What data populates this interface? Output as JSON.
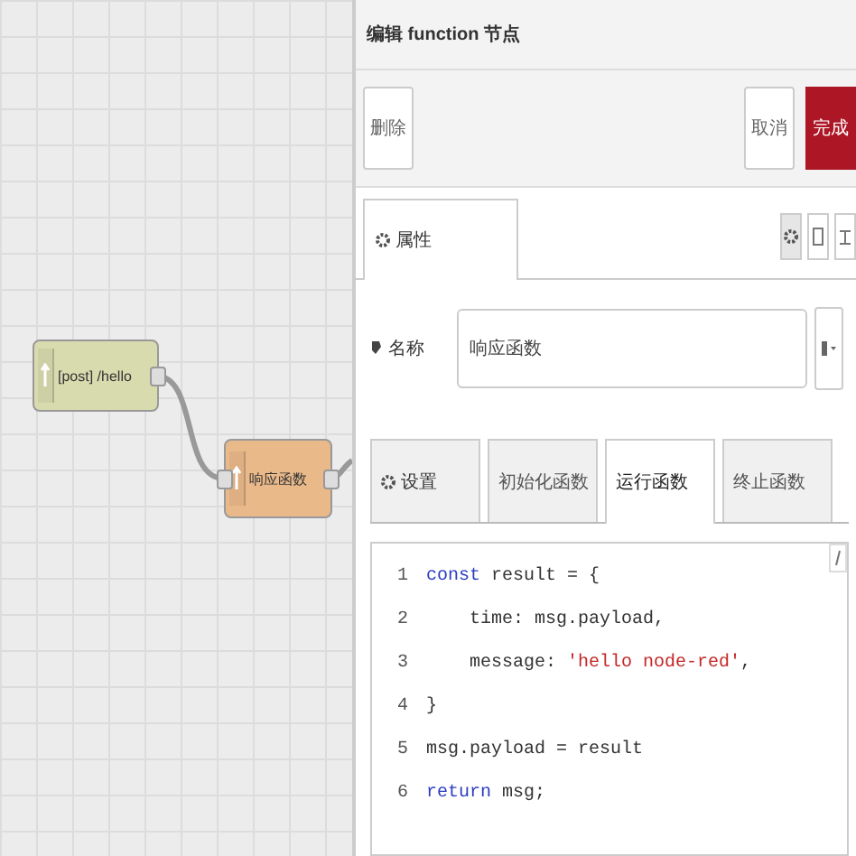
{
  "canvas": {
    "nodes": [
      {
        "label": "[post] /hello",
        "color": "#d8dbae"
      },
      {
        "label": "响应函数",
        "color": "#e9b98a"
      }
    ]
  },
  "tray": {
    "title": "编辑 function 节点",
    "buttons": [
      {
        "label": "删除",
        "kind": "plain"
      },
      {
        "label": "取消",
        "kind": "plain"
      },
      {
        "label": "完成",
        "kind": "primary"
      }
    ],
    "tabs": [
      {
        "label": "属性",
        "selected": true
      }
    ],
    "name_field": {
      "label": "名称",
      "value": "响应函数"
    },
    "sub_tabs": [
      {
        "label": "设置",
        "selected": false
      },
      {
        "label": "初始化函数",
        "selected": false
      },
      {
        "label": "运行函数",
        "selected": true
      },
      {
        "label": "终止函数",
        "selected": false
      }
    ],
    "code": [
      {
        "number": "1",
        "tokens": [
          {
            "text": "const",
            "kind": "keyword"
          },
          {
            "text": " result = {",
            "kind": "plain"
          }
        ]
      },
      {
        "number": "2",
        "tokens": [
          {
            "text": "    time: msg.payload,",
            "kind": "plain"
          }
        ]
      },
      {
        "number": "3",
        "tokens": [
          {
            "text": "    message: ",
            "kind": "plain"
          },
          {
            "text": "'hello node-red'",
            "kind": "string"
          },
          {
            "text": ",",
            "kind": "plain"
          }
        ]
      },
      {
        "number": "4",
        "tokens": [
          {
            "text": "}",
            "kind": "plain"
          }
        ]
      },
      {
        "number": "5",
        "tokens": [
          {
            "text": "msg.payload = result",
            "kind": "plain"
          }
        ]
      },
      {
        "number": "6",
        "tokens": [
          {
            "text": "return",
            "kind": "keyword"
          },
          {
            "text": " msg;",
            "kind": "plain"
          }
        ]
      }
    ]
  }
}
